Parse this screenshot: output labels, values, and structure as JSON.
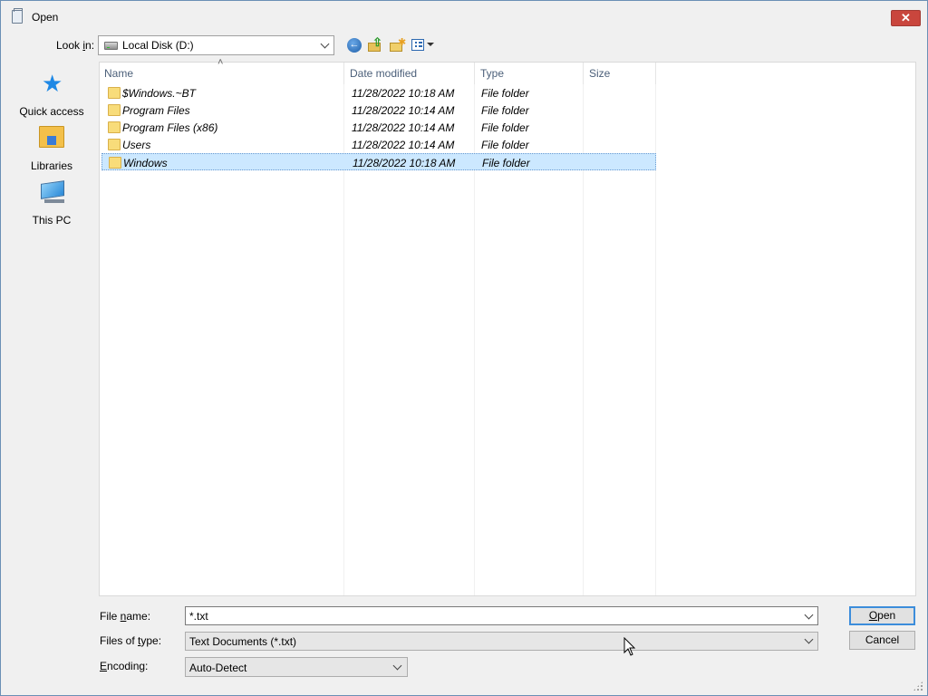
{
  "window": {
    "title": "Open",
    "close_glyph": "✕"
  },
  "toolbar": {
    "lookin_label_pre": "Look ",
    "lookin_label_key": "i",
    "lookin_label_post": "n:",
    "lookin_value": "Local Disk (D:)",
    "icons": [
      "drive-icon",
      "back-icon",
      "up-folder-icon",
      "new-folder-icon",
      "views-menu-icon"
    ]
  },
  "places": [
    {
      "label": "Quick access",
      "icon": "star-icon"
    },
    {
      "label": "Libraries",
      "icon": "libraries-icon"
    },
    {
      "label": "This PC",
      "icon": "computer-icon"
    }
  ],
  "columns": [
    {
      "label": "Name"
    },
    {
      "label": "Date modified"
    },
    {
      "label": "Type"
    },
    {
      "label": "Size"
    }
  ],
  "rows": [
    {
      "name": "$Windows.~BT",
      "date": "11/28/2022 10:18 AM",
      "type": "File folder",
      "selected": false
    },
    {
      "name": "Program Files",
      "date": "11/28/2022 10:14 AM",
      "type": "File folder",
      "selected": false
    },
    {
      "name": "Program Files (x86)",
      "date": "11/28/2022 10:14 AM",
      "type": "File folder",
      "selected": false
    },
    {
      "name": "Users",
      "date": "11/28/2022 10:14 AM",
      "type": "File folder",
      "selected": false
    },
    {
      "name": "Windows",
      "date": "11/28/2022 10:18 AM",
      "type": "File folder",
      "selected": true
    }
  ],
  "fields": {
    "filename_label_pre": "File ",
    "filename_label_key": "n",
    "filename_label_post": "ame:",
    "filename_value": "*.txt",
    "filetype_label_pre": "Files of ",
    "filetype_label_key": "t",
    "filetype_label_post": "ype:",
    "filetype_value": "Text Documents (*.txt)",
    "encoding_label_pre": "",
    "encoding_label_key": "E",
    "encoding_label_post": "ncoding:",
    "encoding_value": "Auto-Detect"
  },
  "buttons": {
    "open_key": "O",
    "open_rest": "pen",
    "cancel": "Cancel"
  },
  "colors": {
    "selection": "#cce8ff",
    "accent": "#3c8ddb",
    "close": "#c9463d"
  }
}
